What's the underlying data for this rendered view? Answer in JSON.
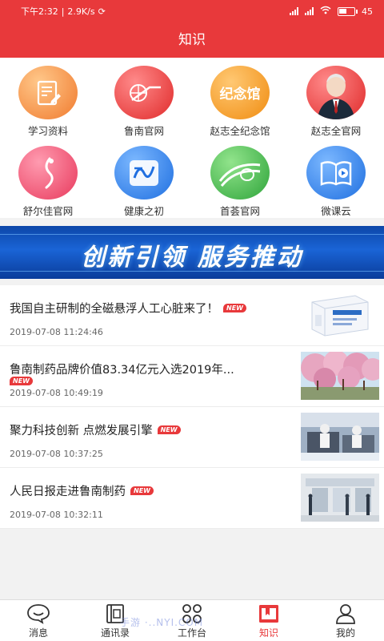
{
  "status_bar": {
    "time": "下午2:32",
    "speed": "2.9K/s",
    "battery": "45"
  },
  "header": {
    "title": "知识"
  },
  "grid": [
    {
      "label": "学习资料",
      "icon": "document-edit-icon",
      "color_from": "#ffb066",
      "color_to": "#f07a2e"
    },
    {
      "label": "鲁南官网",
      "icon": "lunan-logo-icon",
      "color_from": "#ff6b6b",
      "color_to": "#e02a2a"
    },
    {
      "label": "赵志全纪念馆",
      "icon": "memorial-hall-icon",
      "color_from": "#ffb84d",
      "color_to": "#f08c10",
      "icon_text": "纪念馆"
    },
    {
      "label": "赵志全官网",
      "icon": "portrait-icon",
      "color_from": "#ff6b6b",
      "color_to": "#e02a2a"
    },
    {
      "label": "舒尔佳官网",
      "icon": "shuerjia-logo-icon",
      "color_from": "#ff7f9a",
      "color_to": "#e8395c"
    },
    {
      "label": "健康之初",
      "icon": "health-logo-icon",
      "color_from": "#5aa4ff",
      "color_to": "#1f6fe0"
    },
    {
      "label": "首荟官网",
      "icon": "shouhui-logo-icon",
      "color_from": "#6fd66a",
      "color_to": "#2ea43a"
    },
    {
      "label": "微课云",
      "icon": "video-book-icon",
      "color_from": "#5aa4ff",
      "color_to": "#1f6fe0"
    }
  ],
  "banner": {
    "text": "创新引领 服务推动"
  },
  "news": [
    {
      "title": "我国自主研制的全磁悬浮人工心脏来了！",
      "date": "2019-07-08 11:24:46",
      "badge": "NEW",
      "thumb": "medicine-box-image"
    },
    {
      "title": "鲁南制药品牌价值83.34亿元入选2019年...",
      "date": "2019-07-08 10:49:19",
      "badge": "NEW",
      "thumb": "cherry-blossom-image"
    },
    {
      "title": "聚力科技创新 点燃发展引擎",
      "date": "2019-07-08 10:37:25",
      "badge": "NEW",
      "thumb": "laboratory-image"
    },
    {
      "title": "人民日报走进鲁南制药",
      "date": "2019-07-08 10:32:11",
      "badge": "NEW",
      "thumb": "factory-visit-image"
    }
  ],
  "tabbar": [
    {
      "label": "消息",
      "icon": "chat-bubble-icon",
      "active": false
    },
    {
      "label": "通讯录",
      "icon": "contacts-book-icon",
      "active": false
    },
    {
      "label": "工作台",
      "icon": "workbench-grid-icon",
      "active": false
    },
    {
      "label": "知识",
      "icon": "knowledge-book-icon",
      "active": true
    },
    {
      "label": "我的",
      "icon": "person-icon",
      "active": false
    }
  ],
  "watermark": "手游 ·..NYI.COM",
  "colors": {
    "accent": "#e8393b"
  }
}
